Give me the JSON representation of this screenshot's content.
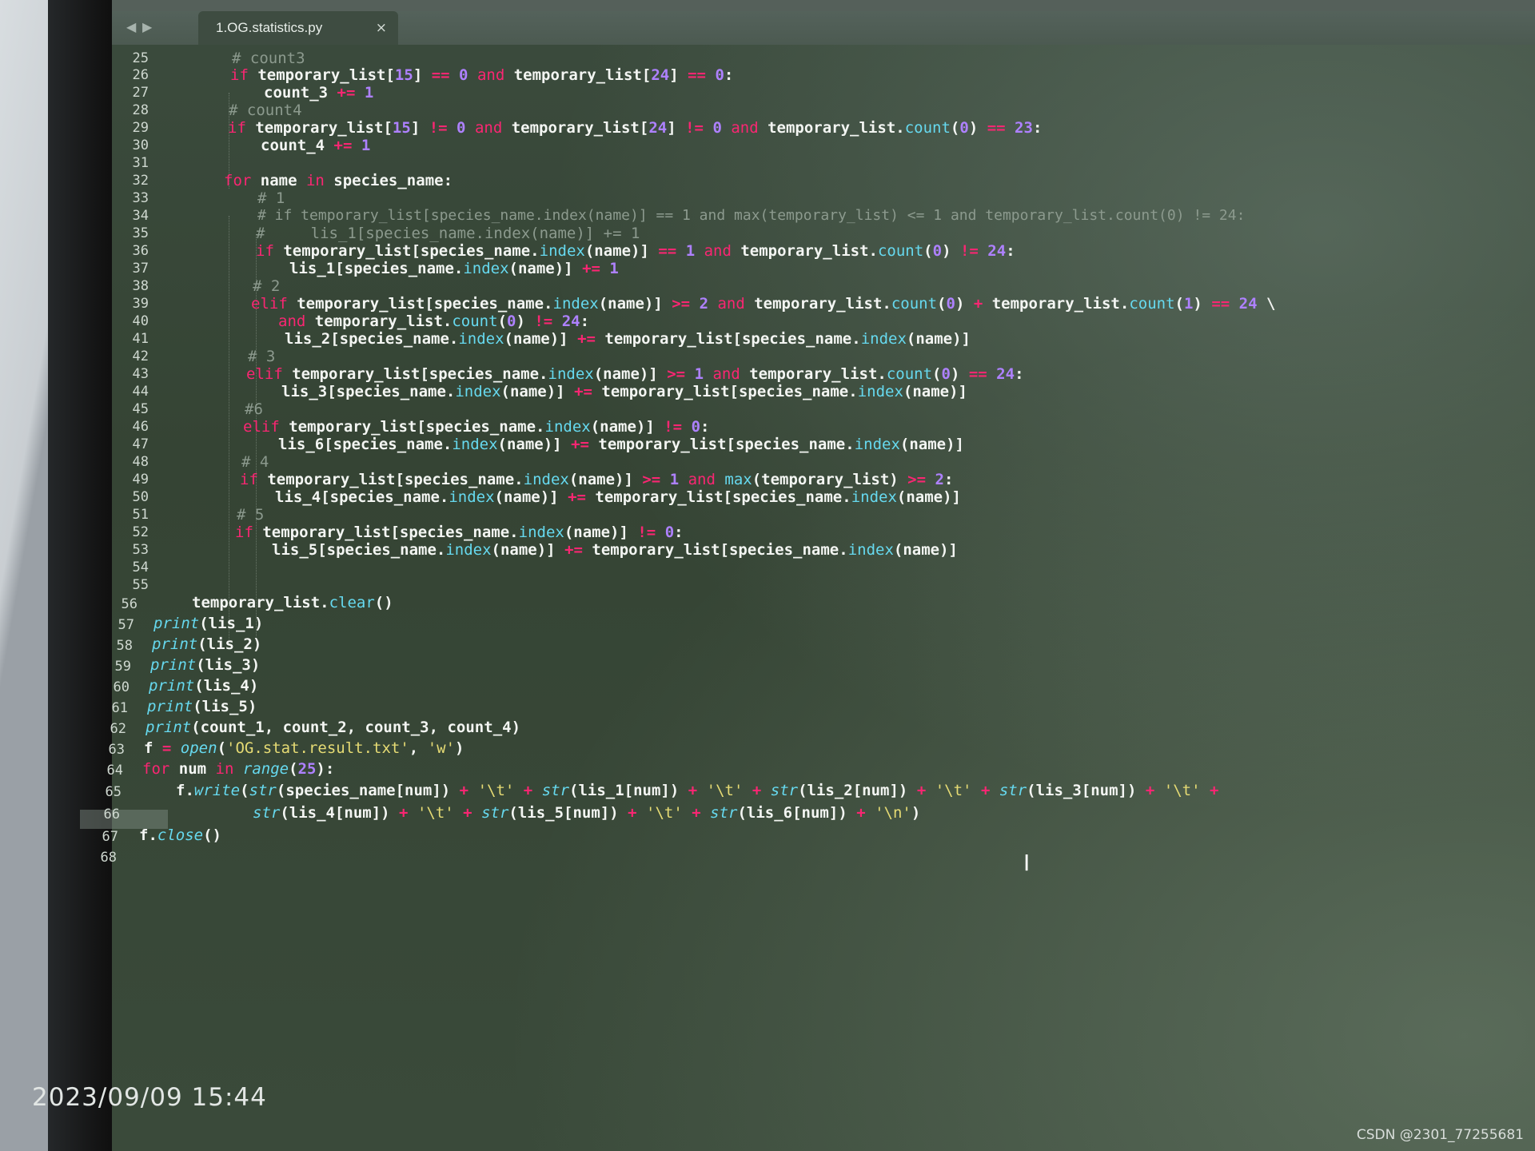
{
  "editor": {
    "tab_title": "1.OG.statistics.py",
    "tab_close": "×",
    "nav_back": "◀",
    "nav_forward": "▶",
    "line_numbers": [
      "25",
      "26",
      "27",
      "28",
      "29",
      "30",
      "31",
      "32",
      "33",
      "34",
      "35",
      "36",
      "37",
      "38",
      "39",
      "40",
      "41",
      "42",
      "43",
      "44",
      "45",
      "46",
      "47",
      "48",
      "49",
      "50",
      "51",
      "52",
      "53",
      "54",
      "55",
      "56",
      "57",
      "58",
      "59",
      "60",
      "61",
      "62",
      "63",
      "64",
      "65",
      "66",
      "67",
      "68"
    ],
    "highlighted_line": "65",
    "code_lines": [
      "# count3",
      "if temporary_list[15] == 0 and temporary_list[24] == 0:",
      "count_3 += 1",
      "# count4",
      "if temporary_list[15] != 0 and temporary_list[24] != 0 and temporary_list.count(0) == 23:",
      "count_4 += 1",
      "",
      "for name in species_name:",
      "# 1",
      "# if temporary_list[species_name.index(name)] == 1 and max(temporary_list) <= 1 and temporary_list.count(0) != 24:",
      "#     lis_1[species_name.index(name)] += 1",
      "if temporary_list[species_name.index(name)] == 1 and temporary_list.count(0) != 24:",
      "lis_1[species_name.index(name)] += 1",
      "# 2",
      "elif temporary_list[species_name.index(name)] >= 2 and temporary_list.count(0) + temporary_list.count(1) == 24 \\",
      "and temporary_list.count(0) != 24:",
      "lis_2[species_name.index(name)] += temporary_list[species_name.index(name)]",
      "# 3",
      "elif temporary_list[species_name.index(name)] >= 1 and temporary_list.count(0) == 24:",
      "lis_3[species_name.index(name)] += temporary_list[species_name.index(name)]",
      "#6",
      "elif temporary_list[species_name.index(name)] != 0:",
      "lis_6[species_name.index(name)] += temporary_list[species_name.index(name)]",
      "# 4",
      "if temporary_list[species_name.index(name)] >= 1 and max(temporary_list) >= 2:",
      "lis_4[species_name.index(name)] += temporary_list[species_name.index(name)]",
      "# 5",
      "if temporary_list[species_name.index(name)] != 0:",
      "lis_5[species_name.index(name)] += temporary_list[species_name.index(name)]",
      "",
      "",
      "temporary_list.clear()",
      "print(lis_1)",
      "print(lis_2)",
      "print(lis_3)",
      "print(lis_4)",
      "print(lis_5)",
      "print(count_1, count_2, count_3, count_4)",
      "f = open('OG.stat.result.txt', 'w')",
      "for num in range(25):",
      "f.write(str(species_name[num]) + '\\t' + str(lis_1[num]) + '\\t' + str(lis_2[num]) + '\\t' + str(lis_3[num]) + '\\t' +",
      "str(lis_4[num]) + '\\t' + str(lis_5[num]) + '\\t' + str(lis_6[num]) + '\\n')",
      "f.close()",
      ""
    ]
  },
  "overlay": {
    "timestamp": "2023/09/09 15:44",
    "watermark": "CSDN @2301_77255681"
  },
  "colors": {
    "keyword": "#f92672",
    "number": "#ae81ff",
    "string": "#e6db74",
    "comment": "#8c9a8e",
    "function": "#66d9ef",
    "background": "#3a4a3a"
  },
  "icons": [
    "back-arrow-icon",
    "forward-arrow-icon",
    "close-icon",
    "text-cursor-icon"
  ]
}
